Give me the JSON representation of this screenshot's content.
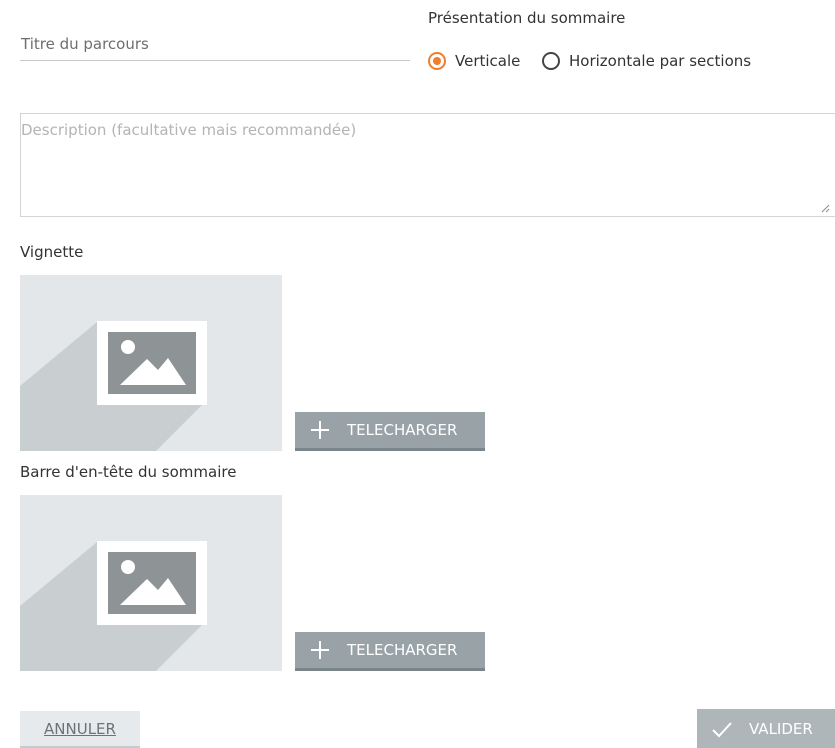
{
  "form": {
    "title_placeholder": "Titre du parcours",
    "presentation": {
      "label": "Présentation du sommaire",
      "options": [
        {
          "label": "Verticale",
          "selected": true
        },
        {
          "label": "Horizontale par sections",
          "selected": false
        }
      ]
    },
    "description_placeholder": "Description (facultative mais recommandée)",
    "thumbnail": {
      "label": "Vignette",
      "upload_label": "TELECHARGER"
    },
    "header_bar": {
      "label": "Barre d'en-tête du sommaire",
      "upload_label": "TELECHARGER"
    }
  },
  "actions": {
    "cancel_label": "ANNULER",
    "validate_label": "VALIDER"
  },
  "icons": {
    "upload": "plus-icon",
    "validate": "check-icon",
    "placeholder": "image-placeholder-icon"
  },
  "colors": {
    "accent": "#f07d2a",
    "button_gray": "#99a3a7",
    "placeholder_bg": "#e3e7ea"
  }
}
